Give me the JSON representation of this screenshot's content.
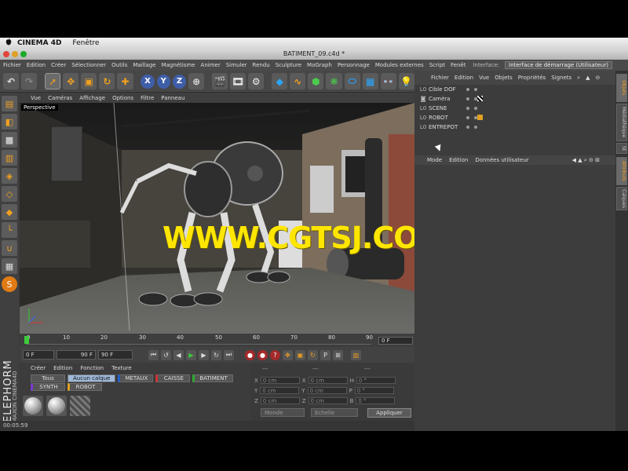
{
  "mac_menu": {
    "apple": "",
    "app": "CINEMA 4D",
    "window": "Fenêtre"
  },
  "title": "BATIMENT_09.c4d *",
  "menubar": {
    "items": [
      "Fichier",
      "Edition",
      "Créer",
      "Sélectionner",
      "Outils",
      "Maillage",
      "Magnétisme",
      "Animer",
      "Simuler",
      "Rendu",
      "Sculpture",
      "MoGraph",
      "Personnage",
      "Modules externes",
      "Script",
      "Fenêt"
    ],
    "interface_label": "Interface:",
    "interface_value": "Interface de démarrage (Utilisateur)"
  },
  "toolbar_letters": {
    "x": "X",
    "y": "Y",
    "z": "Z"
  },
  "view_menu": [
    "Vue",
    "Caméras",
    "Affichage",
    "Options",
    "Filtre",
    "Panneau"
  ],
  "viewport": {
    "label": "Perspective",
    "watermark": "WWW.CGTSJ.COM"
  },
  "timeline": {
    "ticks": [
      "0",
      "10",
      "20",
      "30",
      "40",
      "50",
      "60",
      "70",
      "80",
      "90"
    ],
    "frame": "0 F"
  },
  "playbar": {
    "start": "0 F",
    "current": "90 F",
    "end": "90 F"
  },
  "material": {
    "menu": [
      "Créer",
      "Edition",
      "Fonction",
      "Texture"
    ],
    "tags": [
      "Tous",
      "Aucun calque",
      "METAUX",
      "CAISSE",
      "BATIMENT",
      "SYNTH",
      "ROBOT"
    ],
    "active_tag": "Aucun calque",
    "tag_colors": {
      "METAUX": "#1e5fcc",
      "CAISSE": "#d03030",
      "BATIMENT": "#2faa2f",
      "SYNTH": "#7a3ad0",
      "ROBOT": "#e0a020"
    }
  },
  "coords": {
    "header": [
      "---",
      "---",
      "---"
    ],
    "rows": [
      {
        "a": "X",
        "av": "0 cm",
        "b": "X",
        "bv": "0 cm",
        "c": "H",
        "cv": "0 °"
      },
      {
        "a": "Y",
        "av": "0 cm",
        "b": "Y",
        "bv": "0 cm",
        "c": "P",
        "cv": "0 °"
      },
      {
        "a": "Z",
        "av": "0 cm",
        "b": "Z",
        "bv": "0 cm",
        "c": "B",
        "cv": "0 °"
      }
    ],
    "mode": "Monde",
    "scale": "Echelle",
    "apply": "Appliquer"
  },
  "status": "00:05:59",
  "objects_menu": [
    "Fichier",
    "Edition",
    "Vue",
    "Objets",
    "Propriétés",
    "Signets"
  ],
  "objects": [
    {
      "name": "Cible DOF",
      "icon": "L0"
    },
    {
      "name": "Caméra",
      "icon": "◙"
    },
    {
      "name": "SCENE",
      "icon": "L0"
    },
    {
      "name": "ROBOT",
      "icon": "L0"
    },
    {
      "name": "ENTREPOT",
      "icon": "L0"
    }
  ],
  "attr_menu": [
    "Mode",
    "Edition",
    "Données utilisateur"
  ],
  "side_tabs": [
    "Objets",
    "Médiathèque",
    "St",
    "Attributs",
    "Calques"
  ],
  "brand": {
    "main": "ELEPHORM",
    "sub": "MAXON CINEMA4D"
  }
}
